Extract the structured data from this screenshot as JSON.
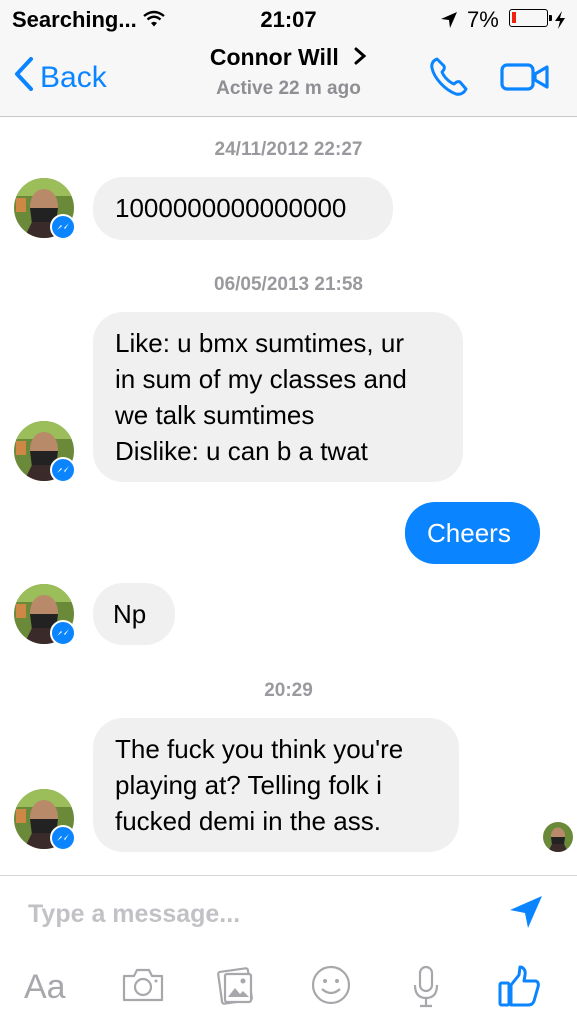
{
  "status_bar": {
    "carrier": "Searching...",
    "time": "21:07",
    "battery_percent": "7%"
  },
  "header": {
    "back_label": "Back",
    "contact_name": "Connor Will",
    "activity": "Active 22 m ago"
  },
  "messages": {
    "ts1": "24/11/2012 22:27",
    "m1": "1000000000000000",
    "ts2": "06/05/2013 21:58",
    "m2_lines": [
      "Like: u bmx sumtimes, ur",
      "in sum of my classes and",
      "we talk sumtimes",
      "Dislike: u can b a twat"
    ],
    "m3": "Cheers",
    "m4": "Np",
    "ts3": "20:29",
    "m5_lines": [
      "The fuck you think you're",
      "playing at? Telling folk i",
      "fucked demi in the ass."
    ]
  },
  "composer": {
    "placeholder": "Type a message...",
    "aa_label": "Aa"
  },
  "colors": {
    "accent": "#0a84ff",
    "incoming_bubble": "#f1f0f0",
    "muted_text": "#8e8e93"
  },
  "icons": [
    "wifi-icon",
    "location-arrow-icon",
    "battery-icon",
    "charging-bolt-icon",
    "back-chevron-icon",
    "chevron-right-icon",
    "phone-icon",
    "video-camera-icon",
    "messenger-badge-icon",
    "send-icon",
    "camera-icon",
    "photo-gallery-icon",
    "emoji-icon",
    "microphone-icon",
    "thumbs-up-icon"
  ]
}
